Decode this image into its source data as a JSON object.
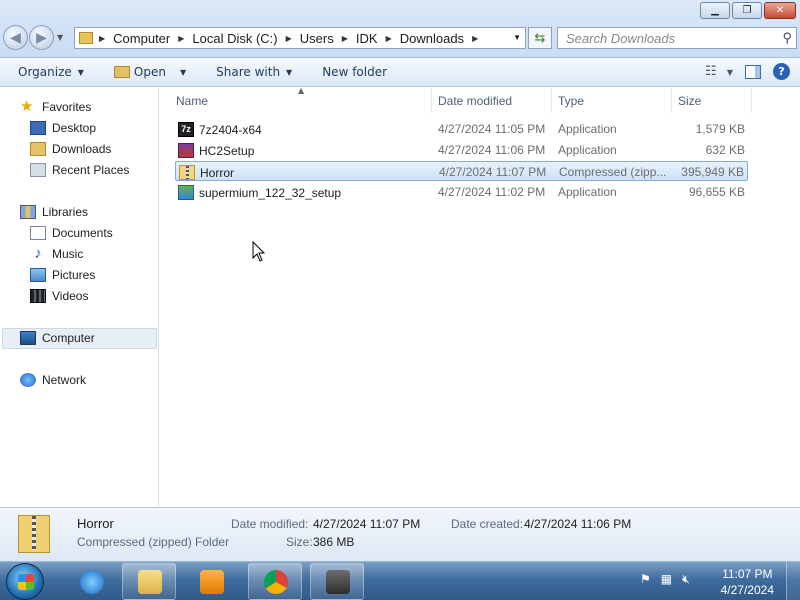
{
  "address": {
    "crumbs": [
      "Computer",
      "Local Disk (C:)",
      "Users",
      "IDK",
      "Downloads"
    ]
  },
  "search": {
    "placeholder": "Search Downloads"
  },
  "toolbar": {
    "organize": "Organize",
    "open": "Open",
    "share_with": "Share with",
    "new_folder": "New folder"
  },
  "nav": {
    "favorites": "Favorites",
    "desktop": "Desktop",
    "downloads": "Downloads",
    "recent_places": "Recent Places",
    "libraries": "Libraries",
    "documents": "Documents",
    "music": "Music",
    "pictures": "Pictures",
    "videos": "Videos",
    "computer": "Computer",
    "network": "Network"
  },
  "columns": {
    "name": "Name",
    "date_modified": "Date modified",
    "type": "Type",
    "size": "Size"
  },
  "files": [
    {
      "name": "7z2404-x64",
      "date": "4/27/2024 11:05 PM",
      "type": "Application",
      "size": "1,579 KB",
      "icon": "7zip-icon"
    },
    {
      "name": "HC2Setup",
      "date": "4/27/2024 11:06 PM",
      "type": "Application",
      "size": "632 KB",
      "icon": "installer-icon"
    },
    {
      "name": "Horror",
      "date": "4/27/2024 11:07 PM",
      "type": "Compressed (zipp...",
      "size": "395,949 KB",
      "icon": "zip-folder-icon",
      "selected": true
    },
    {
      "name": "supermium_122_32_setup",
      "date": "4/27/2024 11:02 PM",
      "type": "Application",
      "size": "96,655 KB",
      "icon": "setup-icon"
    }
  ],
  "details": {
    "name": "Horror",
    "type": "Compressed (zipped) Folder",
    "date_modified_label": "Date modified:",
    "date_modified": "4/27/2024 11:07 PM",
    "date_created_label": "Date created:",
    "date_created": "4/27/2024 11:06 PM",
    "size_label": "Size:",
    "size": "386 MB"
  },
  "taskbar": {
    "time": "11:07 PM",
    "date": "4/27/2024"
  }
}
